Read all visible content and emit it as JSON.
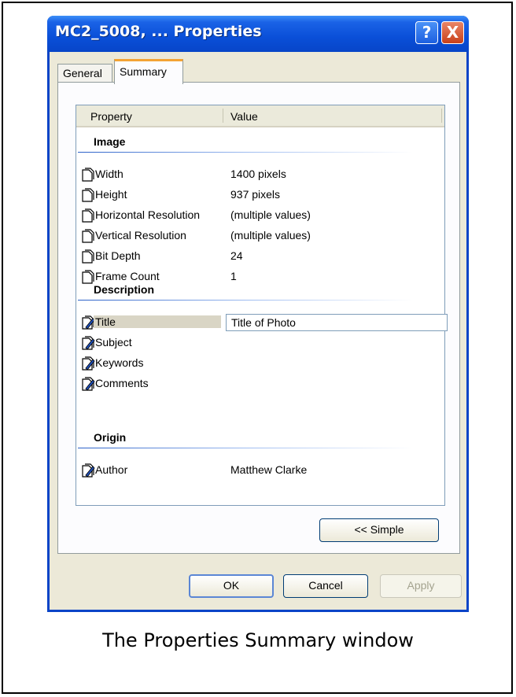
{
  "window": {
    "title": "MC2_5008, ... Properties",
    "help_glyph": "?",
    "close_glyph": "X"
  },
  "tabs": [
    {
      "label": "General",
      "selected": false
    },
    {
      "label": "Summary",
      "selected": true
    }
  ],
  "list": {
    "columns": [
      "Property",
      "Value"
    ],
    "groups": [
      {
        "name": "Image",
        "items": [
          {
            "name": "Width",
            "value": "1400 pixels",
            "icon": "readonly-page-icon"
          },
          {
            "name": "Height",
            "value": "937 pixels",
            "icon": "readonly-page-icon"
          },
          {
            "name": "Horizontal Resolution",
            "value": "(multiple values)",
            "icon": "readonly-page-icon"
          },
          {
            "name": "Vertical Resolution",
            "value": "(multiple values)",
            "icon": "readonly-page-icon"
          },
          {
            "name": "Bit Depth",
            "value": "24",
            "icon": "readonly-page-icon"
          },
          {
            "name": "Frame Count",
            "value": "1",
            "icon": "readonly-page-icon"
          }
        ]
      },
      {
        "name": "Description",
        "items": [
          {
            "name": "Title",
            "value": "Title of Photo",
            "icon": "editable-page-icon",
            "editing": true
          },
          {
            "name": "Subject",
            "value": "",
            "icon": "editable-page-icon"
          },
          {
            "name": "Keywords",
            "value": "",
            "icon": "editable-page-icon"
          },
          {
            "name": "Comments",
            "value": "",
            "icon": "editable-page-icon"
          }
        ]
      },
      {
        "name": "Origin",
        "items": [
          {
            "name": "Author",
            "value": "Matthew Clarke",
            "icon": "editable-page-icon"
          }
        ]
      }
    ]
  },
  "buttons": {
    "simple": "<< Simple",
    "ok": "OK",
    "cancel": "Cancel",
    "apply": "Apply",
    "apply_enabled": false
  },
  "caption": "The Properties Summary window",
  "colors": {
    "titlebar": "#0a4fd8",
    "dialog_bg": "#ece9d8",
    "group_line": "#2a60c8",
    "tab_highlight": "#f3a334",
    "close_button": "#c8401a"
  }
}
